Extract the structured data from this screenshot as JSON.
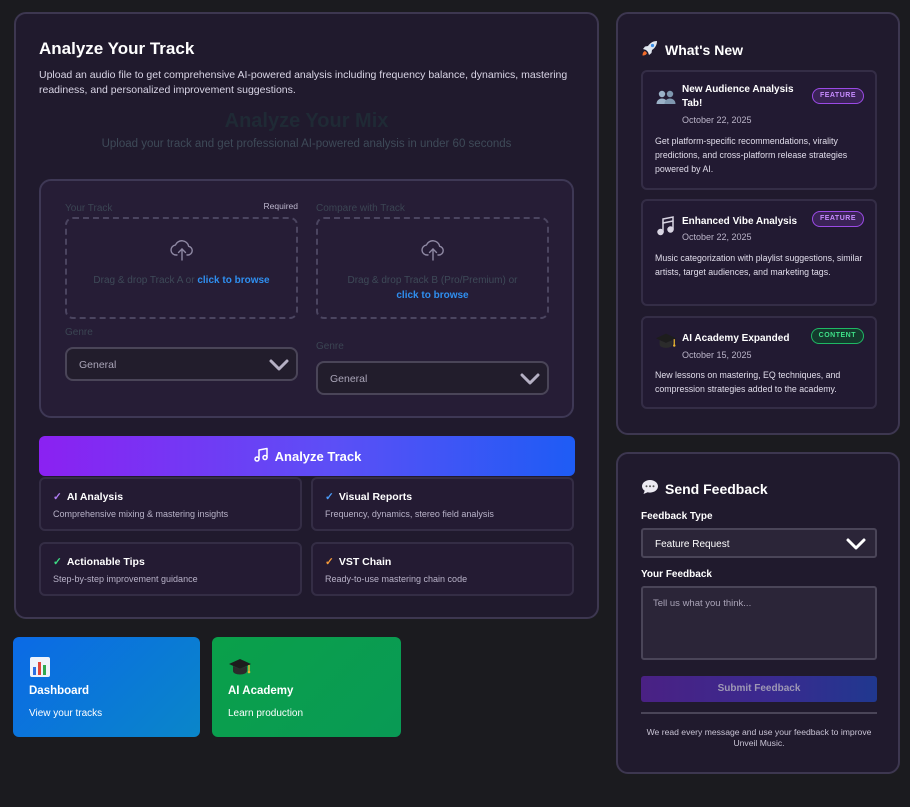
{
  "main": {
    "title": "Analyze Your Track",
    "description": "Upload an audio file to get comprehensive AI-powered analysis including frequency balance, dynamics, mastering readiness, and personalized improvement suggestions.",
    "ghost_title": "Analyze Your Mix",
    "ghost_subtitle": "Upload your track and get professional AI-powered analysis in under 60 seconds",
    "track_a": {
      "label": "Your Track",
      "required": "Required",
      "drop_text": "Drag & drop Track A or ",
      "browse": "click to browse",
      "genre_label": "Genre",
      "genre_value": "General"
    },
    "track_b": {
      "label": "Compare with Track",
      "drop_text": "Drag & drop Track B (Pro/Premium) or ",
      "browse": "click to browse",
      "genre_label": "Genre",
      "genre_value": "General"
    },
    "analyze_button": "Analyze Track",
    "features": [
      {
        "title": "AI Analysis",
        "desc": "Comprehensive mixing & mastering insights",
        "check_color": "#b07cf5"
      },
      {
        "title": "Visual Reports",
        "desc": "Frequency, dynamics, stereo field analysis",
        "check_color": "#4a9bf7"
      },
      {
        "title": "Actionable Tips",
        "desc": "Step-by-step improvement guidance",
        "check_color": "#3ddc84"
      },
      {
        "title": "VST Chain",
        "desc": "Ready-to-use mastering chain code",
        "check_color": "#f59a3a"
      }
    ]
  },
  "tiles": {
    "dashboard": {
      "title": "Dashboard",
      "desc": "View your tracks",
      "icon": "bar-chart-icon"
    },
    "academy": {
      "title": "AI Academy",
      "desc": "Learn production",
      "icon": "graduation-cap-icon"
    }
  },
  "news": {
    "title": "What's New",
    "icon": "rocket-icon",
    "items": [
      {
        "title": "New Audience Analysis Tab!",
        "badge": "FEATURE",
        "date": "October 22, 2025",
        "text": "Get platform-specific recommendations, virality predictions, and cross-platform release strategies powered by AI.",
        "icon": "people-icon"
      },
      {
        "title": "Enhanced Vibe Analysis",
        "badge": "FEATURE",
        "date": "October 22, 2025",
        "text": "Music categorization with playlist suggestions, similar artists, target audiences, and marketing tags.",
        "icon": "music-notes-icon"
      },
      {
        "title": "AI Academy Expanded",
        "badge": "CONTENT",
        "date": "October 15, 2025",
        "text": "New lessons on mastering, EQ techniques, and compression strategies added to the academy.",
        "icon": "graduation-cap-icon"
      }
    ]
  },
  "feedback": {
    "title": "Send Feedback",
    "icon": "speech-bubble-icon",
    "type_label": "Feedback Type",
    "type_value": "Feature Request",
    "message_label": "Your Feedback",
    "placeholder": "Tell us what you think...",
    "submit": "Submit Feedback",
    "footer": "We read every message and use your feedback to improve Unveil Music."
  },
  "colors": {
    "accent_purple": "#8b21f2",
    "accent_blue": "#1e5cf5",
    "link": "#2f8ff0",
    "panel_bg": "#201a2d"
  }
}
